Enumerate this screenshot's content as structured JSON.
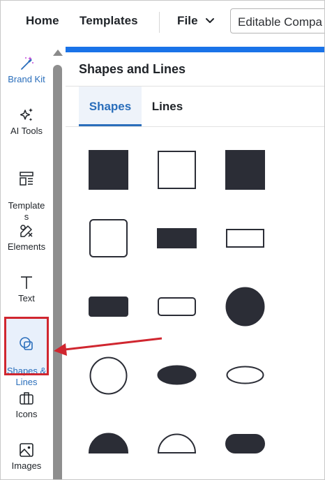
{
  "topnav": {
    "home": "Home",
    "templates": "Templates",
    "file": "File",
    "document_title": "Editable Compa"
  },
  "sidebar": {
    "items": [
      {
        "label": "Brand Kit",
        "icon": "magic-wand-icon"
      },
      {
        "label": "AI Tools",
        "icon": "sparkles-icon"
      },
      {
        "label": "Template\ns",
        "icon": "layout-icon"
      },
      {
        "label": "Elements",
        "icon": "elements-icon"
      },
      {
        "label": "Text",
        "icon": "text-icon"
      },
      {
        "label": "Shapes &\nLines",
        "icon": "shapes-icon",
        "active": true
      },
      {
        "label": "Icons",
        "icon": "briefcase-icon"
      },
      {
        "label": "Images",
        "icon": "image-icon"
      }
    ]
  },
  "panel": {
    "title": "Shapes and Lines",
    "tabs": [
      {
        "label": "Shapes",
        "selected": true
      },
      {
        "label": "Lines",
        "selected": false
      }
    ],
    "shapes": [
      {
        "name": "filled-square"
      },
      {
        "name": "outlined-square"
      },
      {
        "name": "filled-square-alt"
      },
      {
        "name": "rounded-outlined-square"
      },
      {
        "name": "filled-rectangle"
      },
      {
        "name": "outlined-rectangle"
      },
      {
        "name": "filled-rounded-rectangle"
      },
      {
        "name": "outlined-rounded-rectangle"
      },
      {
        "name": "filled-circle"
      },
      {
        "name": "outlined-circle"
      },
      {
        "name": "filled-ellipse"
      },
      {
        "name": "outlined-ellipse"
      },
      {
        "name": "filled-half-circle"
      },
      {
        "name": "outlined-half-circle"
      },
      {
        "name": "filled-pill"
      }
    ]
  },
  "colors": {
    "accent": "#2a6ebb",
    "panel_bar": "#1a73e8",
    "shape_fill": "#2b2d36",
    "annotation": "#d0262f"
  }
}
